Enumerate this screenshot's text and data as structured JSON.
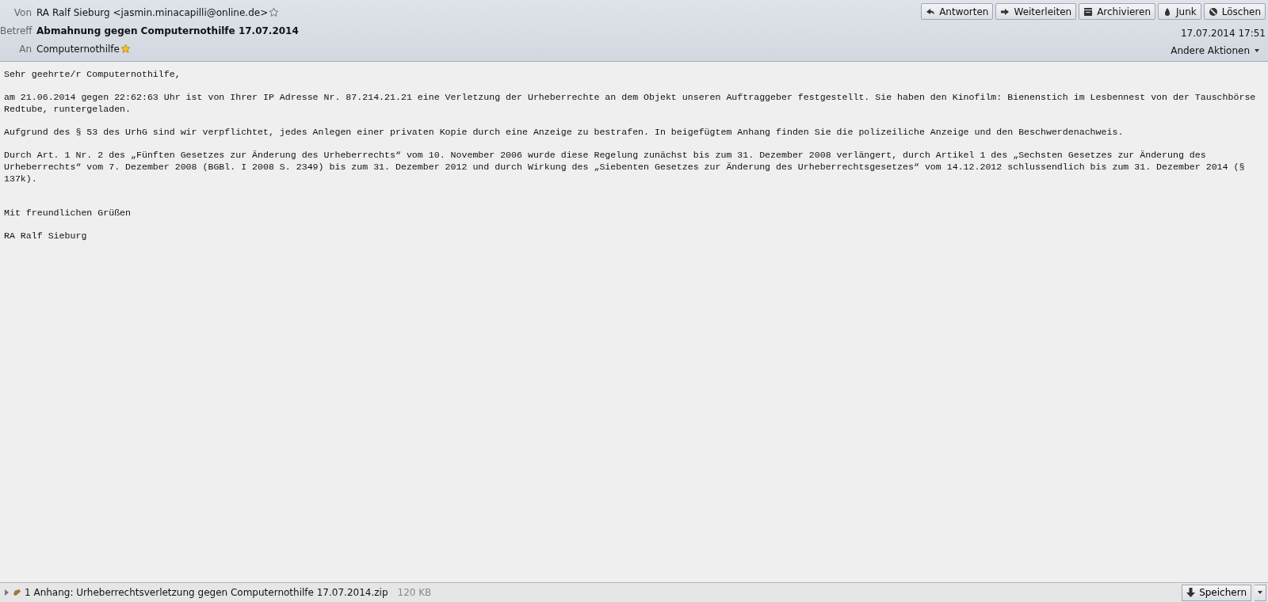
{
  "header": {
    "fields": [
      {
        "label": "Von",
        "value": "RA Ralf Sieburg <jasmin.minacapilli@online.de>",
        "bold": false,
        "starred": false
      },
      {
        "label": "Betreff",
        "value": "Abmahnung gegen Computernothilfe 17.07.2014",
        "bold": true
      },
      {
        "label": "An",
        "value": "Computernothilfe",
        "bold": false,
        "starred": true
      }
    ],
    "buttons": [
      {
        "label": "Antworten",
        "kind": "reply"
      },
      {
        "label": "Weiterleiten",
        "kind": "forward"
      },
      {
        "label": "Archivieren",
        "kind": "archive"
      },
      {
        "label": "Junk",
        "kind": "junk"
      },
      {
        "label": "Löschen",
        "kind": "delete"
      }
    ],
    "date": "17.07.2014 17:51",
    "other_actions": "Andere Aktionen"
  },
  "body": {
    "paragraphs": [
      "Sehr geehrte/r Computernothilfe,",
      "am 21.06.2014 gegen 22:62:63 Uhr ist von Ihrer IP Adresse Nr. 87.214.21.21 eine Verletzung der Urheberrechte an dem Objekt unseren Auftraggeber festgestellt. Sie haben den Kinofilm: Bienenstich im Lesbennest von der Tauschbörse Redtube, runtergeladen.",
      "Aufgrund des § 53 des UrhG sind wir verpflichtet, jedes Anlegen einer privaten Kopie durch eine Anzeige zu bestrafen. In beigefügtem Anhang finden Sie die polizeiliche Anzeige und den Beschwerdenachweis.",
      "Durch Art. 1 Nr. 2 des „Fünften Gesetzes zur Änderung des Urheberrechts“ vom 10. November 2006 wurde diese Regelung zunächst bis zum 31. Dezember 2008 verlängert, durch Artikel 1 des „Sechsten Gesetzes zur Änderung des Urheberrechts“ vom 7. Dezember 2008 (BGBl. I 2008 S. 2349) bis zum 31. Dezember 2012 und durch Wirkung des „Siebenten Gesetzes zur Änderung des Urheberrechtsgesetzes“ vom 14.12.2012 schlussendlich bis zum 31. Dezember 2014 (§ 137k)."
    ],
    "closing": [
      "Mit freundlichen Grüßen",
      "RA Ralf Sieburg"
    ]
  },
  "attachment_bar": {
    "expanded": false,
    "summary": "1 Anhang: Urheberrechtsverletzung gegen Computernothilfe 17.07.2014.zip",
    "size": "120 KB",
    "save_button": "Speichern"
  }
}
